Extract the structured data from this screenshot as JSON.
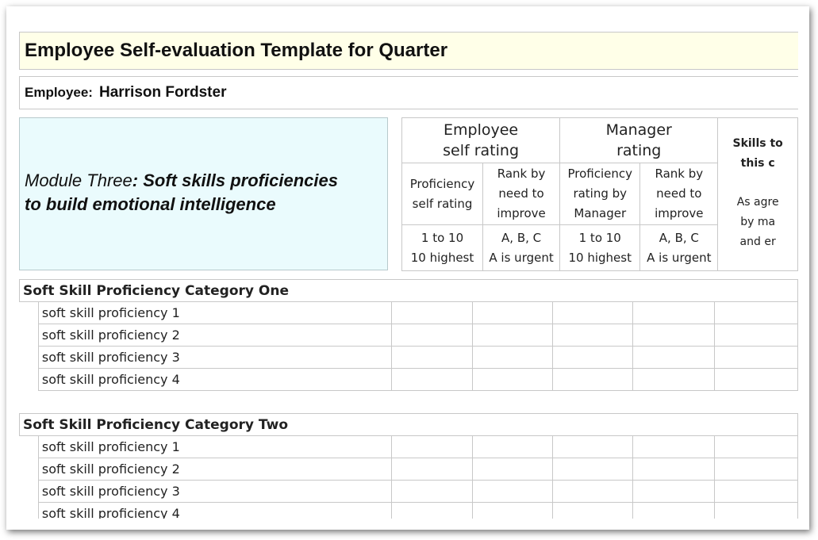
{
  "document": {
    "title": "Employee Self-evaluation Template for Quarter",
    "employee_label": "Employee:",
    "employee_name": "Harrison Fordster",
    "module_name": "Module Three",
    "module_sep": ":",
    "module_desc_line1": "Soft skills proficiencies",
    "module_desc_line2": "to build emotional intelligence"
  },
  "header": {
    "employee_group": [
      "Employee",
      "self rating"
    ],
    "manager_group": [
      "Manager",
      "rating"
    ],
    "columns": [
      {
        "sub": [
          "Proficiency",
          "self rating"
        ],
        "scale": [
          "1 to 10",
          "10 highest"
        ]
      },
      {
        "sub": [
          "Rank by",
          "need to",
          "improve"
        ],
        "scale": [
          "A, B, C",
          "A is urgent"
        ]
      },
      {
        "sub": [
          "Proficiency",
          "rating by",
          "Manager"
        ],
        "scale": [
          "1 to 10",
          "10 highest"
        ]
      },
      {
        "sub": [
          "Rank by",
          "need to",
          "improve"
        ],
        "scale": [
          "A, B, C",
          "A is urgent"
        ]
      }
    ],
    "skills_col": {
      "line1": "Skills to",
      "line2": "this c",
      "line3": "As agre",
      "line4": "by ma",
      "line5": "and er"
    }
  },
  "categories": [
    {
      "name": "Soft Skill Proficiency Category One",
      "items": [
        "soft skill proficiency 1",
        "soft skill proficiency 2",
        "soft skill proficiency 3",
        "soft skill proficiency 4"
      ]
    },
    {
      "name": "Soft Skill Proficiency Category Two",
      "items": [
        "soft skill proficiency 1",
        "soft skill proficiency 2",
        "soft skill proficiency 3",
        "soft skill proficiency 4"
      ]
    }
  ]
}
